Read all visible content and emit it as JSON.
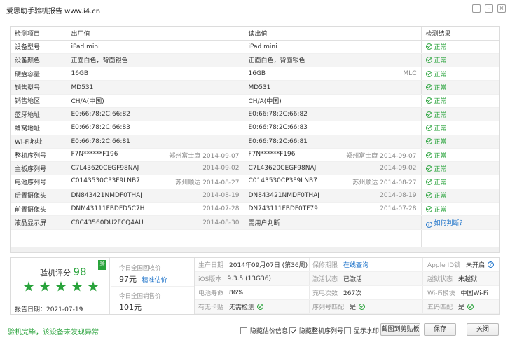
{
  "window": {
    "title": "爱思助手验机报告 www.i4.cn",
    "settings_symbol": "⋯",
    "minimize_symbol": "–",
    "close_symbol": "×"
  },
  "table": {
    "headers": [
      "检测项目",
      "出厂值",
      "读出值",
      "检测结果"
    ],
    "rows": [
      {
        "item": "设备型号",
        "factory": "iPad mini",
        "factory_meta": "",
        "factory_date": "",
        "read": "iPad mini",
        "read_meta": "",
        "read_date": "",
        "result": "正常",
        "result_type": "ok"
      },
      {
        "item": "设备颜色",
        "factory": "正面白色，背面银色",
        "factory_meta": "",
        "factory_date": "",
        "read": "正面白色，背面银色",
        "read_meta": "",
        "read_date": "",
        "result": "正常",
        "result_type": "ok"
      },
      {
        "item": "硬盘容量",
        "factory": "16GB",
        "factory_meta": "",
        "factory_date": "",
        "read": "16GB",
        "read_meta": "",
        "read_date": "MLC",
        "result": "正常",
        "result_type": "ok"
      },
      {
        "item": "销售型号",
        "factory": "MD531",
        "factory_meta": "",
        "factory_date": "",
        "read": "MD531",
        "read_meta": "",
        "read_date": "",
        "result": "正常",
        "result_type": "ok"
      },
      {
        "item": "销售地区",
        "factory": "CH/A(中国)",
        "factory_meta": "",
        "factory_date": "",
        "read": "CH/A(中国)",
        "read_meta": "",
        "read_date": "",
        "result": "正常",
        "result_type": "ok"
      },
      {
        "item": "蓝牙地址",
        "factory": "E0:66:78:2C:66:82",
        "factory_meta": "",
        "factory_date": "",
        "read": "E0:66:78:2C:66:82",
        "read_meta": "",
        "read_date": "",
        "result": "正常",
        "result_type": "ok"
      },
      {
        "item": "蜂窝地址",
        "factory": "E0:66:78:2C:66:83",
        "factory_meta": "",
        "factory_date": "",
        "read": "E0:66:78:2C:66:83",
        "read_meta": "",
        "read_date": "",
        "result": "正常",
        "result_type": "ok"
      },
      {
        "item": "Wi-Fi地址",
        "factory": "E0:66:78:2C:66:81",
        "factory_meta": "",
        "factory_date": "",
        "read": "E0:66:78:2C:66:81",
        "read_meta": "",
        "read_date": "",
        "result": "正常",
        "result_type": "ok"
      },
      {
        "item": "整机序列号",
        "factory": "F7N******F196",
        "factory_meta": "郑州富士康",
        "factory_date": "2014-09-07",
        "read": "F7N******F196",
        "read_meta": "郑州富士康",
        "read_date": "2014-09-07",
        "result": "正常",
        "result_type": "ok"
      },
      {
        "item": "主板序列号",
        "factory": "C7L43620CEGF98NAJ",
        "factory_meta": "",
        "factory_date": "2014-09-02",
        "read": "C7L43620CEGF98NAJ",
        "read_meta": "",
        "read_date": "2014-09-02",
        "result": "正常",
        "result_type": "ok"
      },
      {
        "item": "电池序列号",
        "factory": "C0143530CP3F9LNB7",
        "factory_meta": "苏州顺达",
        "factory_date": "2014-08-27",
        "read": "C0143530CP3F9LNB7",
        "read_meta": "苏州顺达",
        "read_date": "2014-08-27",
        "result": "正常",
        "result_type": "ok"
      },
      {
        "item": "后置摄像头",
        "factory": "DN843421NMDF0THAJ",
        "factory_meta": "",
        "factory_date": "2014-08-19",
        "read": "DN843421NMDF0THAJ",
        "read_meta": "",
        "read_date": "2014-08-19",
        "result": "正常",
        "result_type": "ok"
      },
      {
        "item": "前置摄像头",
        "factory": "DNM43111FBDFD5C7H",
        "factory_meta": "",
        "factory_date": "2014-07-28",
        "read": "DN743111FBDF0TF79",
        "read_meta": "",
        "read_date": "2014-07-28",
        "result": "正常",
        "result_type": "ok"
      },
      {
        "item": "液晶显示屏",
        "factory": "C8C43560DU2FCQ4AU",
        "factory_meta": "",
        "factory_date": "2014-08-30",
        "read": "需用户判断",
        "read_meta": "",
        "read_date": "",
        "result": "如何判断？",
        "result_type": "question"
      }
    ]
  },
  "summary": {
    "score_label": "验机评分",
    "score": "98",
    "star_count": 5,
    "badge": "验",
    "report_date": "报告日期：2021-07-19",
    "recycle_label": "今日全国回收价",
    "recycle_price": "97元",
    "recycle_link": "精准估价",
    "sale_label": "今日全国销售价",
    "sale_price": "101元",
    "grid": [
      [
        {
          "k": "生产日期",
          "v": "2014年09月07日 (第36周)"
        },
        {
          "k": "保修期限",
          "v": "在线查询",
          "link": true
        },
        {
          "k": "Apple ID锁",
          "v": "未开启",
          "icon": "info"
        }
      ],
      [
        {
          "k": "iOS版本",
          "v": "9.3.5 (13G36)"
        },
        {
          "k": "激活状态",
          "v": "已激活"
        },
        {
          "k": "越狱状态",
          "v": "未越狱"
        }
      ],
      [
        {
          "k": "电池寿命",
          "v": "86%"
        },
        {
          "k": "充电次数",
          "v": "267次"
        },
        {
          "k": "Wi-Fi模块",
          "v": "中国Wi-Fi"
        }
      ],
      [
        {
          "k": "有无卡贴",
          "v": "无需检测",
          "icon": "ok"
        },
        {
          "k": "序列号匹配",
          "v": "是",
          "icon": "ok"
        },
        {
          "k": "五码匹配",
          "v": "是",
          "icon": "ok"
        }
      ]
    ]
  },
  "footer": {
    "status": "验机完毕，该设备未发现异常",
    "hide_price_label": "隐藏估价信息",
    "hide_serial_label": "隐藏整机序列号",
    "watermark_label": "显示水印",
    "clipboard_label": "截图到剪贴板",
    "save_label": "保存",
    "close_label": "关闭"
  }
}
